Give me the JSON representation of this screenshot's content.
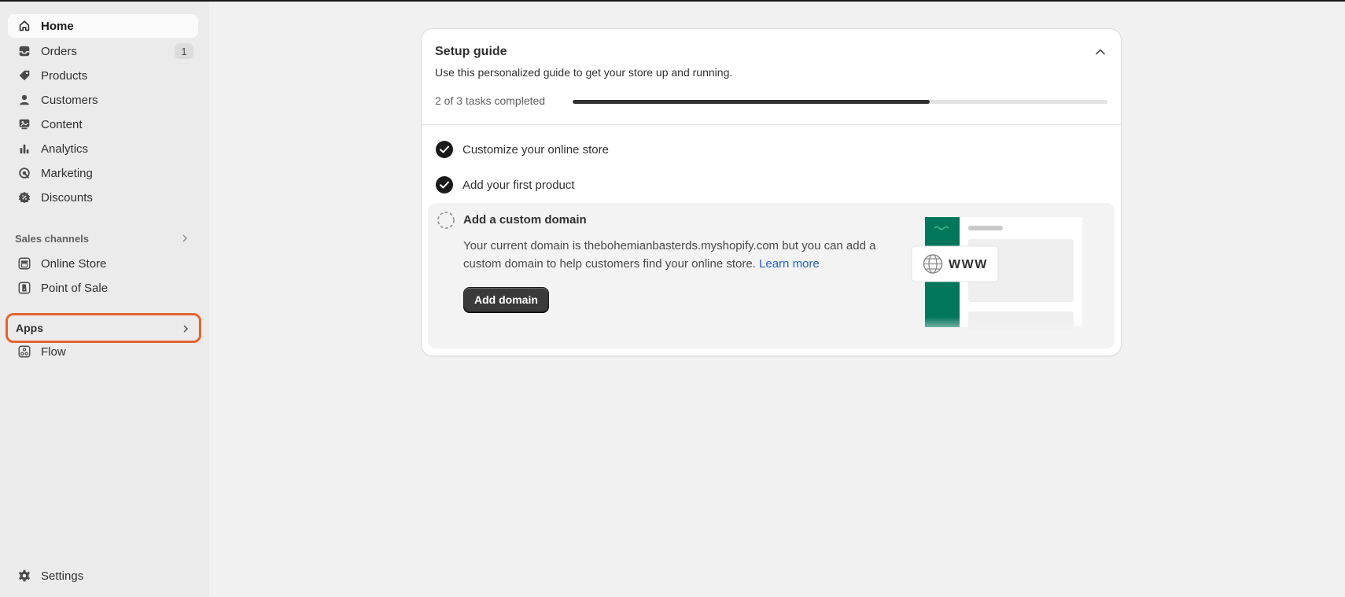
{
  "sidebar": {
    "items": [
      {
        "label": "Home",
        "icon": "home-icon"
      },
      {
        "label": "Orders",
        "icon": "inbox-icon",
        "badge": "1"
      },
      {
        "label": "Products",
        "icon": "tag-icon"
      },
      {
        "label": "Customers",
        "icon": "person-icon"
      },
      {
        "label": "Content",
        "icon": "image-icon"
      },
      {
        "label": "Analytics",
        "icon": "bar-chart-icon"
      },
      {
        "label": "Marketing",
        "icon": "target-icon"
      },
      {
        "label": "Discounts",
        "icon": "discount-icon"
      }
    ],
    "sales_channels": {
      "label": "Sales channels",
      "items": [
        {
          "label": "Online Store",
          "icon": "store-icon"
        },
        {
          "label": "Point of Sale",
          "icon": "pos-icon"
        }
      ]
    },
    "apps": {
      "label": "Apps",
      "items": [
        {
          "label": "Flow",
          "icon": "flow-icon"
        }
      ]
    },
    "settings_label": "Settings"
  },
  "setup_guide": {
    "title": "Setup guide",
    "subtitle": "Use this personalized guide to get your store up and running.",
    "progress_label": "2 of 3 tasks completed",
    "progress_fraction": 0.667,
    "tasks": [
      {
        "label": "Customize your online store",
        "completed": true
      },
      {
        "label": "Add your first product",
        "completed": true
      },
      {
        "label": "Add a custom domain",
        "completed": false,
        "description": "Your current domain is thebohemianbasterds.myshopify.com but you can add a custom domain to help customers find your online store.",
        "link_label": "Learn more",
        "button_label": "Add domain",
        "illustration_text": "WWW"
      }
    ]
  },
  "colors": {
    "accent_highlight": "#e5652f",
    "primary_button": "#3a3a3a",
    "link": "#2463bc",
    "illustration_green": "#00775b"
  }
}
